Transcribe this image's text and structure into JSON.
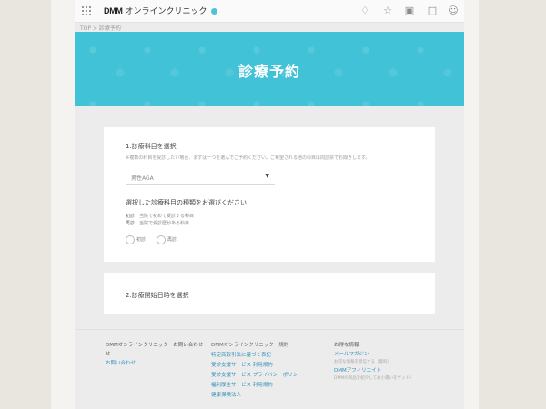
{
  "header": {
    "logo_brand": "DMM",
    "logo_text": "オンラインクリニック",
    "icons": [
      "grid-apps-icon",
      "bell-icon",
      "star-icon",
      "inbox-icon",
      "cart-icon",
      "user-icon"
    ]
  },
  "breadcrumb": {
    "home": "TOP",
    "separator": ">",
    "current": "診療予約"
  },
  "hero": {
    "title": "診療予約"
  },
  "step1": {
    "title": "1.診療科目を選択",
    "note": "※複数の科目を受診したい場合、まずは一つを選んでご予約ください。ご希望される他の科目は問診票でお聞きします。",
    "select_value": "男性AGA",
    "visit_type_title": "選択した診療科目の種類をお選びください",
    "first_label": "初診",
    "first_desc": "当院で初めて受診する科目",
    "return_label": "再診",
    "return_desc": "当院で受診歴がある科目",
    "radio_first": "初診",
    "radio_return": "再診"
  },
  "step2": {
    "title": "2.診療開始日時を選択"
  },
  "footer": {
    "col1": {
      "heading": "DMMオンラインクリニック　お問い合わせ",
      "extra": "せ",
      "link": "お問い合わせ"
    },
    "col2": {
      "heading": "DMMオンラインクリニック　規約",
      "links": [
        "特定商取引法に基づく表記",
        "受診支援サービス 利用規約",
        "受診支援サービス プライバシーポリシー",
        "福利厚生サービス 利用規約",
        "健康保険法人"
      ]
    },
    "col3": {
      "heading": "お得な情報",
      "mail_link": "メールマガジン",
      "mail_sub": "お得な情報を受信する（無料）",
      "affiliate_link": "DMMアフィリエイト",
      "affiliate_sub": "DMMの商品を紹介してお小遣いをゲット！"
    }
  }
}
